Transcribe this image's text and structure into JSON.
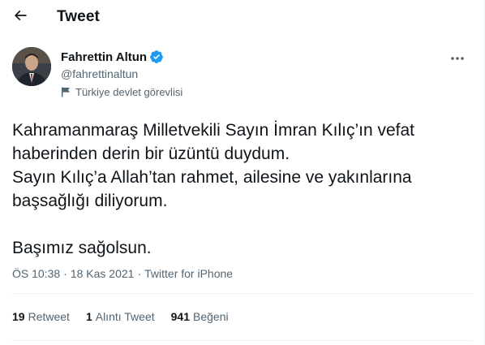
{
  "header": {
    "title": "Tweet",
    "back_icon": "arrow-left-icon"
  },
  "author": {
    "display_name": "Fahrettin Altun",
    "handle": "@fahrettinaltun",
    "verified": true,
    "label": "Türkiye devlet görevlisi",
    "label_icon": "flag-icon"
  },
  "tweet": {
    "lines": [
      "Kahramanmaraş Milletvekili Sayın İmran Kılıç’ın vefat",
      "haberinden derin bir üzüntü duydum.",
      "Sayın Kılıç’a Allah’tan rahmet, ailesine ve yakınlarına",
      "başsağlığı diliyorum.",
      "Başımız sağolsun."
    ],
    "time": "ÖS 10:38",
    "separator": "·",
    "date": "18 Kas 2021",
    "source": "Twitter for iPhone"
  },
  "stats": {
    "retweets_count": "19",
    "retweets_label": "Retweet",
    "quotes_count": "1",
    "quotes_label": "Alıntı Tweet",
    "likes_count": "941",
    "likes_label": "Beğeni"
  },
  "colors": {
    "text": "#0f1419",
    "secondary": "#536471",
    "verified": "#1d9bf0",
    "divider": "#eff3f4"
  }
}
